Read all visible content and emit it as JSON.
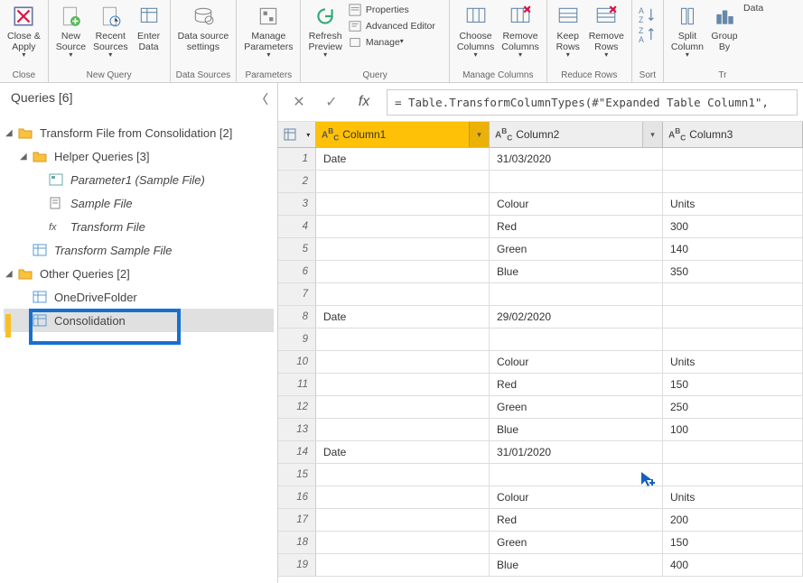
{
  "ribbon": {
    "close_apply": "Close &\nApply",
    "new_source": "New\nSource",
    "recent_sources": "Recent\nSources",
    "enter_data": "Enter\nData",
    "data_settings": "Data source\nsettings",
    "manage_params": "Manage\nParameters",
    "refresh": "Refresh\nPreview",
    "properties": "Properties",
    "adv_editor": "Advanced Editor",
    "manage": "Manage",
    "choose_cols": "Choose\nColumns",
    "remove_cols": "Remove\nColumns",
    "keep_rows": "Keep\nRows",
    "remove_rows": "Remove\nRows",
    "split_col": "Split\nColumn",
    "group_by": "Group\nBy",
    "data_type": "Data",
    "group_close": "Close",
    "group_newquery": "New Query",
    "group_datasources": "Data Sources",
    "group_params": "Parameters",
    "group_query": "Query",
    "group_managecols": "Manage Columns",
    "group_reducerows": "Reduce Rows",
    "group_sort": "Sort",
    "group_tr": "Tr"
  },
  "queries": {
    "header": "Queries [6]",
    "group1": "Transform File from Consolidation [2]",
    "helper": "Helper Queries [3]",
    "param1": "Parameter1 (Sample File)",
    "sample_file": "Sample File",
    "transform_file": "Transform File",
    "transform_sample": "Transform Sample File",
    "other": "Other Queries [2]",
    "onedrive": "OneDriveFolder",
    "consolidation": "Consolidation"
  },
  "formula": "= Table.TransformColumnTypes(#\"Expanded Table Column1\",",
  "columns": [
    "Column1",
    "Column2",
    "Column3"
  ],
  "rows": [
    {
      "n": "1",
      "c": [
        "Date",
        "31/03/2020",
        ""
      ]
    },
    {
      "n": "2",
      "c": [
        "",
        "",
        ""
      ]
    },
    {
      "n": "3",
      "c": [
        "",
        "Colour",
        "Units"
      ]
    },
    {
      "n": "4",
      "c": [
        "",
        "Red",
        "300"
      ]
    },
    {
      "n": "5",
      "c": [
        "",
        "Green",
        "140"
      ]
    },
    {
      "n": "6",
      "c": [
        "",
        "Blue",
        "350"
      ]
    },
    {
      "n": "7",
      "c": [
        "",
        "",
        ""
      ]
    },
    {
      "n": "8",
      "c": [
        "Date",
        "29/02/2020",
        ""
      ]
    },
    {
      "n": "9",
      "c": [
        "",
        "",
        ""
      ]
    },
    {
      "n": "10",
      "c": [
        "",
        "Colour",
        "Units"
      ]
    },
    {
      "n": "11",
      "c": [
        "",
        "Red",
        "150"
      ]
    },
    {
      "n": "12",
      "c": [
        "",
        "Green",
        "250"
      ]
    },
    {
      "n": "13",
      "c": [
        "",
        "Blue",
        "100"
      ]
    },
    {
      "n": "14",
      "c": [
        "Date",
        "31/01/2020",
        ""
      ]
    },
    {
      "n": "15",
      "c": [
        "",
        "",
        ""
      ]
    },
    {
      "n": "16",
      "c": [
        "",
        "Colour",
        "Units"
      ]
    },
    {
      "n": "17",
      "c": [
        "",
        "Red",
        "200"
      ]
    },
    {
      "n": "18",
      "c": [
        "",
        "Green",
        "150"
      ]
    },
    {
      "n": "19",
      "c": [
        "",
        "Blue",
        "400"
      ]
    }
  ]
}
